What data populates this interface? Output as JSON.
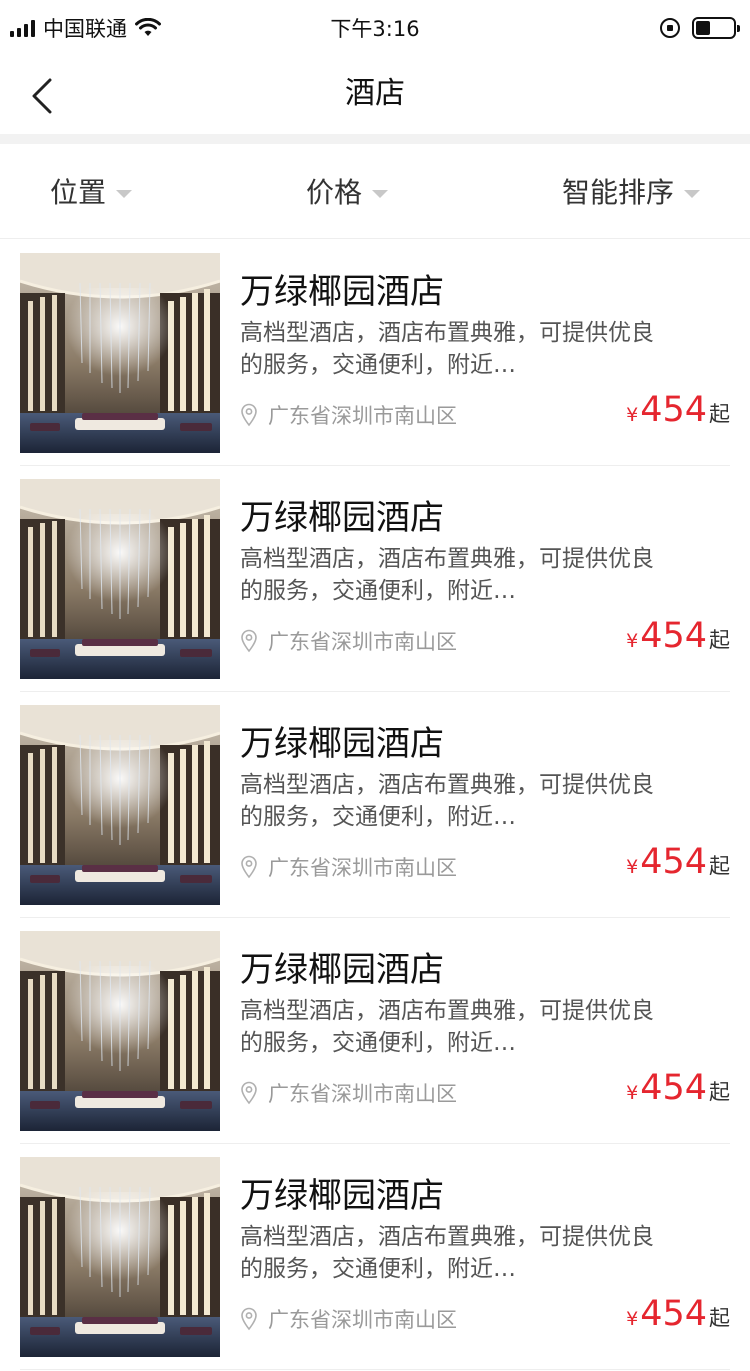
{
  "status_bar": {
    "carrier": "中国联通",
    "time": "下午3:16",
    "battery_level": 0.4
  },
  "nav": {
    "title": "酒店",
    "back_icon": "chevron-left-icon"
  },
  "filters": [
    {
      "label": "位置"
    },
    {
      "label": "价格"
    },
    {
      "label": "智能排序"
    }
  ],
  "colors": {
    "price": "#e5262f",
    "divider": "#f2f2f2"
  },
  "hotels": [
    {
      "name": "万绿椰园酒店",
      "description": "高档型酒店，酒店布置典雅，可提供优良的服务，交通便利，附近…",
      "location": "广东省深圳市南山区",
      "currency": "¥",
      "price": "454",
      "price_suffix": "起"
    },
    {
      "name": "万绿椰园酒店",
      "description": "高档型酒店，酒店布置典雅，可提供优良的服务，交通便利，附近…",
      "location": "广东省深圳市南山区",
      "currency": "¥",
      "price": "454",
      "price_suffix": "起"
    },
    {
      "name": "万绿椰园酒店",
      "description": "高档型酒店，酒店布置典雅，可提供优良的服务，交通便利，附近…",
      "location": "广东省深圳市南山区",
      "currency": "¥",
      "price": "454",
      "price_suffix": "起"
    },
    {
      "name": "万绿椰园酒店",
      "description": "高档型酒店，酒店布置典雅，可提供优良的服务，交通便利，附近…",
      "location": "广东省深圳市南山区",
      "currency": "¥",
      "price": "454",
      "price_suffix": "起"
    },
    {
      "name": "万绿椰园酒店",
      "description": "高档型酒店，酒店布置典雅，可提供优良的服务，交通便利，附近…",
      "location": "广东省深圳市南山区",
      "currency": "¥",
      "price": "454",
      "price_suffix": "起"
    }
  ]
}
